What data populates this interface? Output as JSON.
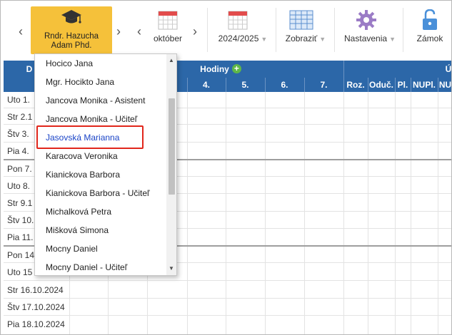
{
  "toolbar": {
    "user_name_line1": "Rndr. Hazucha",
    "user_name_line2": "Adam Phd.",
    "month": "október",
    "school_year": "2024/2025",
    "view": "Zobraziť",
    "settings": "Nastavenia",
    "lock": "Zámok",
    "prev_arrow": "‹",
    "next_arrow": "›",
    "caret": "▼"
  },
  "grid": {
    "first_col_fragment": "D",
    "group_hours": "Hodiny",
    "group_right_fragment": "Ú",
    "hour_cols": [
      "4.",
      "5.",
      "6.",
      "7."
    ],
    "stat_cols": [
      "Roz.",
      "Oduč.",
      "Pl.",
      "NUPl.",
      "NU"
    ],
    "days": [
      "Uto 1.",
      "Str 2.1",
      "Štv 3.",
      "Pia 4.",
      "Pon 7.",
      "Uto 8.",
      "Str 9.1",
      "Štv 10.",
      "Pia 11.",
      "Pon 14",
      "Uto 15",
      "Str 16.10.2024",
      "Štv 17.10.2024",
      "Pia 18.10.2024"
    ]
  },
  "dropdown": {
    "items": [
      "Hocico Jana",
      "Mgr. Hocikto Jana",
      "Jancova Monika - Asistent",
      "Jancova Monika - Učiteľ",
      "Jasovská Marianna",
      "Karacova Veronika",
      "Kianickova Barbora",
      "Kianickova Barbora - Učiteľ",
      "Michalková Petra",
      "Mišková Simona",
      "Mocny Daniel",
      "Mocny Daniel - Učiteľ"
    ],
    "selected_index": 4
  },
  "colors": {
    "header_blue": "#2c67a8",
    "user_button": "#f5c13a",
    "highlight_red": "#e1261b",
    "add_green": "#5fb748",
    "selected_text": "#1a44c7"
  }
}
